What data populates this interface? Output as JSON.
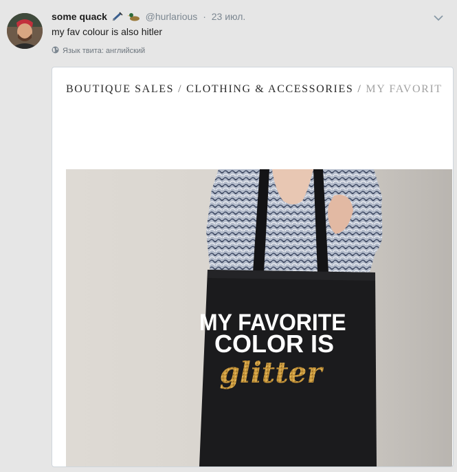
{
  "tweet": {
    "display_name": "some quack",
    "emoji_icons": [
      "syringe-icon",
      "duck-icon"
    ],
    "handle": "@hurlarious",
    "separator": "·",
    "timestamp": "23 июл.",
    "text": "my fav colour is also hitler",
    "language_label": "Язык твита: английский"
  },
  "card": {
    "breadcrumb": {
      "item1": "BOUTIQUE SALES",
      "sep": "/",
      "item2": "CLOTHING & ACCESSORIES",
      "item3": "MY FAVORIT"
    },
    "bag_text": {
      "line1": "MY FAVORITE",
      "line2": "COLOR IS",
      "line3": "glitter"
    }
  },
  "colors": {
    "background": "#e6e6e6",
    "muted_text": "#7c8791",
    "bag": "#1b1b1d",
    "glitter_gold": "#c9973c"
  }
}
